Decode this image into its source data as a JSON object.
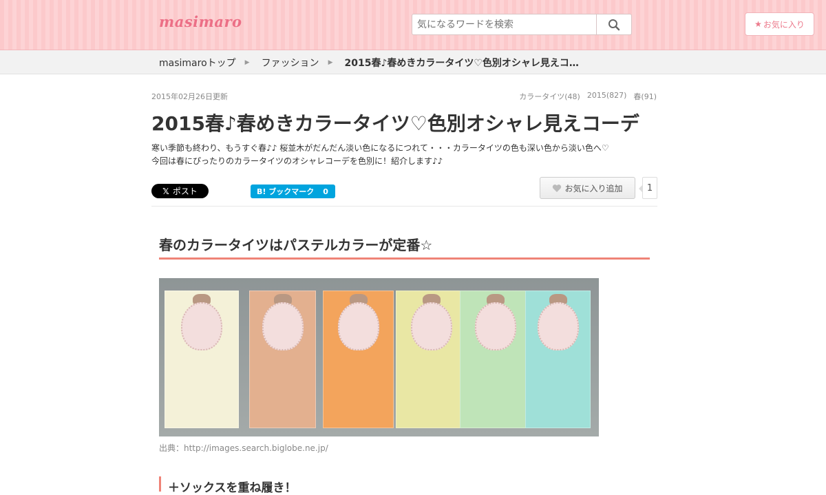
{
  "header": {
    "logo": "masimaro",
    "search_placeholder": "気になるワードを検索",
    "favorites_label": "お気に入り",
    "accent_color": "#ec6f86"
  },
  "breadcrumb": {
    "items": [
      "masimaroトップ",
      "ファッション"
    ],
    "current": "2015春♪春めきカラータイツ♡色別オシャレ見えコ…"
  },
  "article": {
    "updated": "2015年02月26日更新",
    "tags": [
      "カラータイツ(48)",
      "2015(827)",
      "春(91)"
    ],
    "title": "2015春♪春めきカラータイツ♡色別オシャレ見えコーデ",
    "description_line1": "寒い季節も終わり、もうすぐ春♪♪ 桜並木がだんだん淡い色になるにつれて・・・カラータイツの色も深い色から淡い色へ♡",
    "description_line2": "今回は春にぴったりのカラータイツのオシャレコーデを色別に！紹介します♪♪"
  },
  "share": {
    "x_label": "ポスト",
    "hatena_label": "B! ブックマーク",
    "hatena_count": "0",
    "favorite_add_label": "お気に入り追加",
    "favorite_count": "1"
  },
  "section": {
    "heading": "春のカラータイツはパステルカラーが定番☆",
    "image_caption": "出典：http://images.search.biglobe.ne.jp/",
    "image_colors": [
      "#f4f1d8",
      "#e3b08f",
      "#f3a45c",
      "#e9e7a4",
      "#bfe4b8",
      "#9fe0d8"
    ],
    "subheading": "＋ソックスを重ね履き！"
  }
}
